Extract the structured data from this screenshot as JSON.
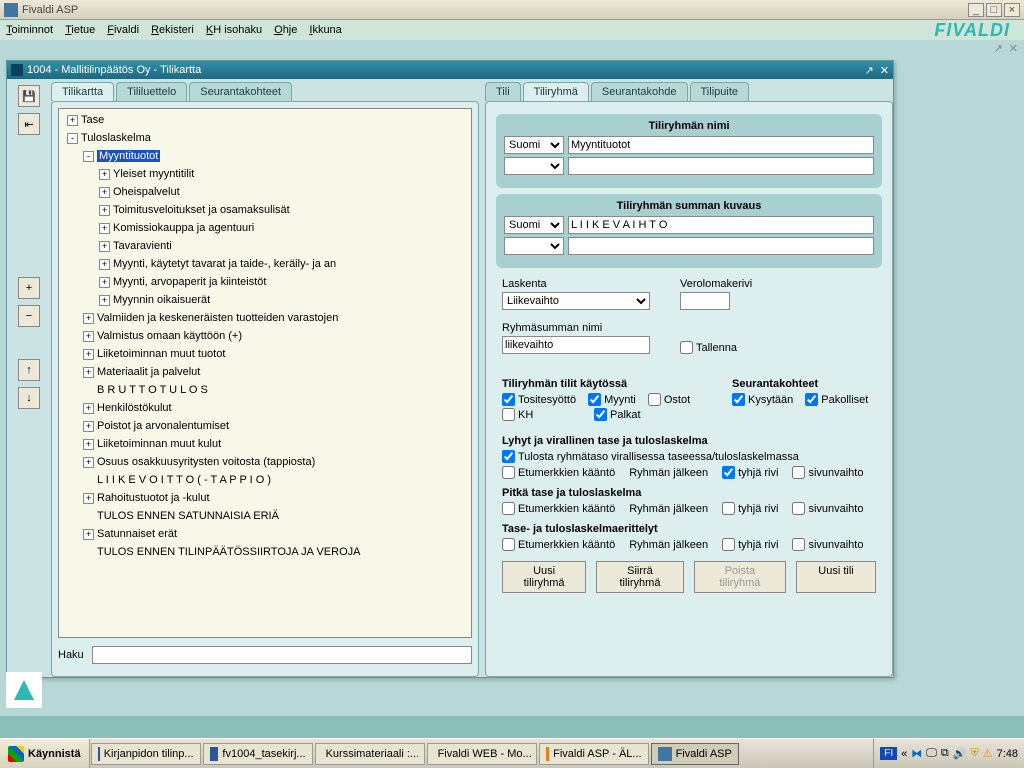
{
  "window": {
    "title": "Fivaldi ASP",
    "min": "_",
    "max": "□",
    "close": "×"
  },
  "menu": {
    "items": [
      "Toiminnot",
      "Tietue",
      "Fivaldi",
      "Rekisteri",
      "KH isohaku",
      "Ohje",
      "Ikkuna"
    ],
    "logo": "FIVALDI"
  },
  "inner": {
    "title": "1004 - Mallitilinpäätös Oy - Tilikartta",
    "maximize": "↗",
    "close": "✕"
  },
  "leftTabs": [
    "Tilikartta",
    "Tililuettelo",
    "Seurantakohteet"
  ],
  "rightTabs": [
    "Tili",
    "Tiliryhmä",
    "Seurantakohde",
    "Tilipuite"
  ],
  "tree": [
    {
      "level": 0,
      "exp": "+",
      "label": "Tase"
    },
    {
      "level": 0,
      "exp": "-",
      "label": "Tuloslaskelma"
    },
    {
      "level": 1,
      "exp": "-",
      "label": "Myyntituotot",
      "selected": true
    },
    {
      "level": 2,
      "exp": "+",
      "label": "Yleiset myyntitilit"
    },
    {
      "level": 2,
      "exp": "+",
      "label": "Oheispalvelut"
    },
    {
      "level": 2,
      "exp": "+",
      "label": "Toimitusveloitukset ja osamaksulisät"
    },
    {
      "level": 2,
      "exp": "+",
      "label": "Komissiokauppa ja agentuuri"
    },
    {
      "level": 2,
      "exp": "+",
      "label": "Tavaravienti"
    },
    {
      "level": 2,
      "exp": "+",
      "label": "Myynti, käytetyt tavarat ja taide-, keräily- ja an"
    },
    {
      "level": 2,
      "exp": "+",
      "label": "Myynti, arvopaperit ja kiinteistöt"
    },
    {
      "level": 2,
      "exp": "+",
      "label": "Myynnin oikaisuerät"
    },
    {
      "level": 1,
      "exp": "+",
      "label": "Valmiiden ja keskeneräisten tuotteiden varastojen"
    },
    {
      "level": 1,
      "exp": "+",
      "label": "Valmistus omaan käyttöön (+)"
    },
    {
      "level": 1,
      "exp": "+",
      "label": "Liiketoiminnan muut tuotot"
    },
    {
      "level": 1,
      "exp": "+",
      "label": "Materiaalit ja palvelut"
    },
    {
      "level": 1,
      "exp": "",
      "label": "B R U T T O T U L O S"
    },
    {
      "level": 1,
      "exp": "+",
      "label": "Henkilöstökulut"
    },
    {
      "level": 1,
      "exp": "+",
      "label": "Poistot ja arvonalentumiset"
    },
    {
      "level": 1,
      "exp": "+",
      "label": "Liiketoiminnan muut kulut"
    },
    {
      "level": 1,
      "exp": "+",
      "label": "Osuus osakkuusyritysten voitosta (tappiosta)"
    },
    {
      "level": 1,
      "exp": "",
      "label": "L I I K E V O I T T O  ( - T A P P I O )"
    },
    {
      "level": 1,
      "exp": "+",
      "label": "Rahoitustuotot ja -kulut"
    },
    {
      "level": 1,
      "exp": "",
      "label": "TULOS ENNEN SATUNNAISIA ERIÄ"
    },
    {
      "level": 1,
      "exp": "+",
      "label": "Satunnaiset erät"
    },
    {
      "level": 1,
      "exp": "",
      "label": "TULOS ENNEN TILINPÄÄTÖSSIIRTOJA  JA VEROJA"
    }
  ],
  "search": {
    "label": "Haku"
  },
  "form": {
    "groupNameHdr": "Tiliryhmän nimi",
    "lang": "Suomi",
    "groupName": "Myyntituotot",
    "sumDescHdr": "Tiliryhmän summan kuvaus",
    "sumDesc": "L I I K E V A I H T O",
    "calcLabel": "Laskenta",
    "calc": "Liikevaihto",
    "taxRowLabel": "Verolomakerivi",
    "groupSumNameLabel": "Ryhmäsumman nimi",
    "groupSumName": "liikevaihto",
    "save": "Tallenna",
    "accountsHdr": "Tiliryhmän tilit käytössä",
    "acc": {
      "tosite": "Tositesyöttö",
      "myynti": "Myynti",
      "ostot": "Ostot",
      "kh": "KH",
      "palkat": "Palkat"
    },
    "trackingHdr": "Seurantakohteet",
    "tracking": {
      "ask": "Kysytään",
      "req": "Pakolliset"
    },
    "shortHdr": "Lyhyt ja virallinen tase ja tuloslaskelma",
    "printGroup": "Tulosta ryhmätaso virallisessa taseessa/tuloslaskelmassa",
    "signFlip": "Etumerkkien kääntö",
    "afterGroup": "Ryhmän jälkeen",
    "emptyRow": "tyhjä rivi",
    "pageBreak": "sivunvaihto",
    "longHdr": "Pitkä tase ja tuloslaskelma",
    "specHdr": "Tase- ja tuloslaskelmaerittelyt"
  },
  "buttons": {
    "new": "Uusi tiliryhmä",
    "move": "Siirrä tiliryhmä",
    "delete": "Poista tiliryhmä",
    "newAccount": "Uusi tili"
  },
  "taskbar": {
    "start": "Käynnistä",
    "tasks": [
      {
        "icon": "#2B579A",
        "label": "Kirjanpidon tilinp..."
      },
      {
        "icon": "#2B579A",
        "label": "fv1004_tasekirj..."
      },
      {
        "icon": "#2B579A",
        "label": "Kurssimateriaali :..."
      },
      {
        "icon": "#E08020",
        "label": "Fivaldi WEB - Mo..."
      },
      {
        "icon": "#E08020",
        "label": "Fivaldi ASP - ÄL..."
      },
      {
        "icon": "#4078A0",
        "label": "Fivaldi ASP",
        "active": true
      }
    ],
    "lang": "FI",
    "time": "7:48"
  }
}
